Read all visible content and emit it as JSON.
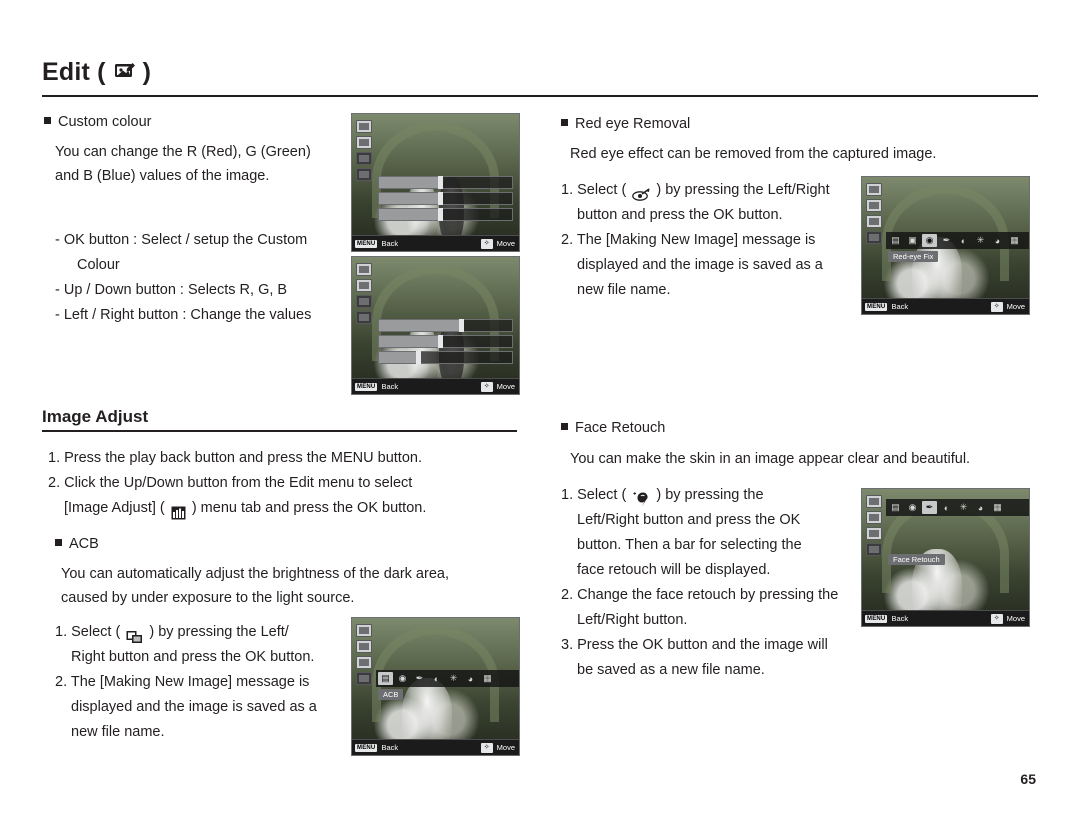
{
  "header": {
    "title": "Edit (",
    "title_close": ")",
    "icon": "edit-pencil-image-icon"
  },
  "page_number": "65",
  "left_column": {
    "custom_colour": {
      "heading": "Custom colour",
      "paragraph": "You can change the R (Red), G (Green)\nand B (Blue) values of the image.",
      "bullets": [
        "- OK button : Select / setup the Custom",
        "Colour",
        "- Up / Down button  : Selects R, G, B",
        "- Left / Right button  : Change the values"
      ]
    },
    "image_adjust": {
      "title": "Image Adjust",
      "steps": [
        "1. Press the play back button and press the MENU button.",
        "2. Click the Up/Down button from the Edit menu to select",
        "[Image Adjust] (",
        ") menu tab and press the OK button."
      ]
    },
    "acb": {
      "heading": "ACB",
      "paragraph": "You can automatically adjust the brightness of the dark area,\ncaused by under exposure to the light source.",
      "steps": [
        {
          "num": "1.",
          "pre": "Select (",
          "post": ") by pressing the Left/",
          "cont": "Right button and press the OK button."
        },
        {
          "num": "2.",
          "pre": "The [Making New Image] message is",
          "cont2": "displayed and the image is saved as a",
          "cont3": "new file name."
        }
      ]
    }
  },
  "right_column": {
    "red_eye": {
      "heading": "Red eye Removal",
      "paragraph": "Red eye effect can be removed from the captured image.",
      "steps": [
        {
          "num": "1.",
          "pre": "Select (",
          "post": ") by pressing the Left/Right",
          "cont": "button and press the OK button."
        },
        {
          "num": "2.",
          "pre": "The [Making New Image] message is",
          "cont2": "displayed and the image is saved as a",
          "cont3": "new file name."
        }
      ]
    },
    "face_retouch": {
      "heading": "Face Retouch",
      "paragraph": "You can make the skin in an image appear clear and beautiful.",
      "steps": [
        {
          "num": "1.",
          "pre": "Select (",
          "post": ") by pressing the",
          "cont": "Left/Right button and press the OK",
          "cont2": "button. Then a bar for selecting the",
          "cont3": "face retouch will be displayed."
        },
        {
          "num": "2.",
          "pre": "Change the face retouch by pressing the",
          "cont": "Left/Right button."
        },
        {
          "num": "3.",
          "pre": "Press the OK button and the image will",
          "cont": "be saved as a new file name."
        }
      ]
    }
  },
  "screens": {
    "custom_colour_1": {
      "back": "Back",
      "menu": "MENU",
      "move": "Move",
      "pad": "✧"
    },
    "custom_colour_2": {
      "back": "Back",
      "menu": "MENU",
      "move": "Move",
      "pad": "✧"
    },
    "acb": {
      "back": "Back",
      "menu": "MENU",
      "move": "Move",
      "pad": "✧",
      "caption": "ACB"
    },
    "red_eye": {
      "back": "Back",
      "menu": "MENU",
      "move": "Move",
      "pad": "✧",
      "caption": "Red-eye Fix"
    },
    "face_retouch": {
      "back": "Back",
      "menu": "MENU",
      "move": "Move",
      "pad": "✧",
      "caption": "Face Retouch"
    }
  }
}
